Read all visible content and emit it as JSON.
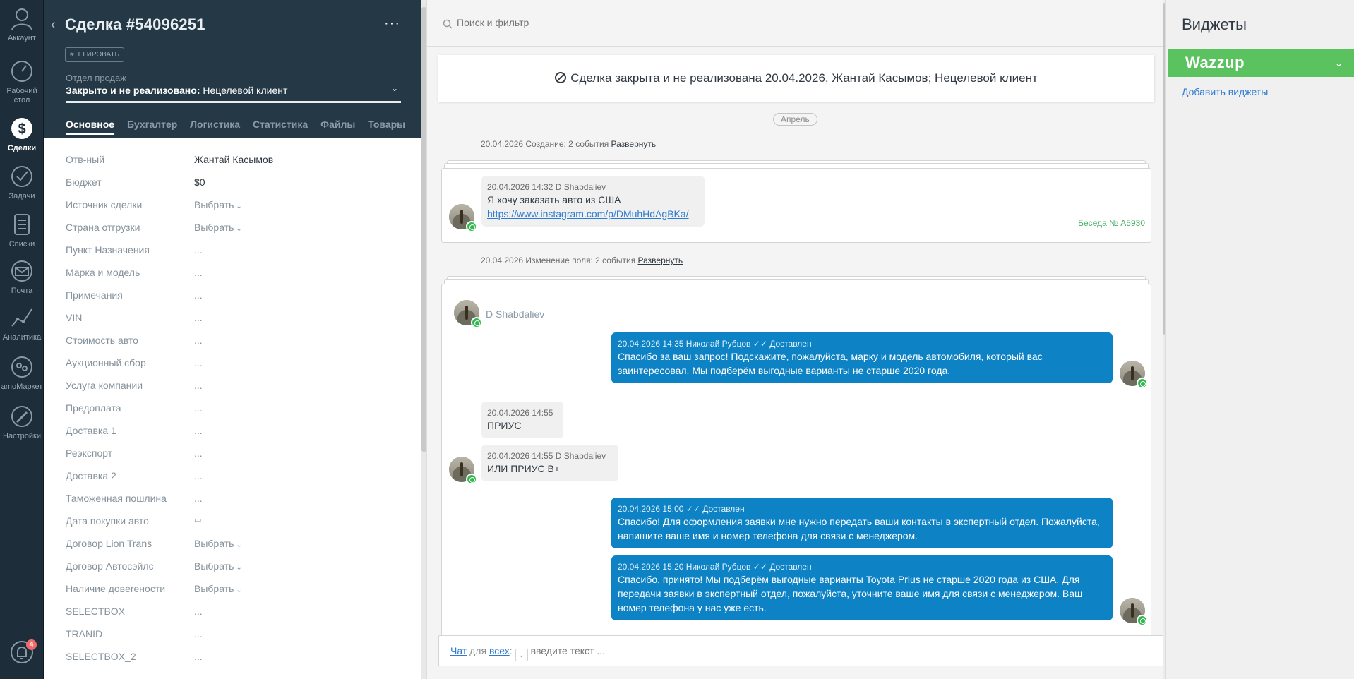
{
  "nav": {
    "items": [
      {
        "label": "Аккаунт"
      },
      {
        "label": "Рабочий стол"
      },
      {
        "label": "Сделки"
      },
      {
        "label": "Задачи"
      },
      {
        "label": "Списки"
      },
      {
        "label": "Почта"
      },
      {
        "label": "Аналитика"
      },
      {
        "label": "amoМаркет"
      },
      {
        "label": "Настройки"
      }
    ],
    "notifications_badge": "4"
  },
  "card": {
    "title": "Сделка #54096251",
    "more": "···",
    "tag_button": "#ТЕГИРОВАТЬ",
    "pipeline_label": "Отдел продаж",
    "pipeline_status_bold": "Закрыто и не реализовано:",
    "pipeline_status_reason": " Нецелевой клиент",
    "tabs": [
      "Основное",
      "Бухгалтер",
      "Логистика",
      "Статистика",
      "Файлы",
      "Товары"
    ],
    "tabs_more": "···",
    "fields": [
      {
        "label": "Отв-ный",
        "value": "Жантай Касымов"
      },
      {
        "label": "Бюджет",
        "value": "$0"
      },
      {
        "label": "Источник сделки",
        "value": "Выбрать"
      },
      {
        "label": "Страна отгрузки",
        "value": "Выбрать"
      },
      {
        "label": "Пункт Назначения",
        "value": "..."
      },
      {
        "label": "Марка и модель",
        "value": "..."
      },
      {
        "label": "Примечания",
        "value": "..."
      },
      {
        "label": "VIN",
        "value": "..."
      },
      {
        "label": "Стоимость авто",
        "value": "..."
      },
      {
        "label": "Аукционный сбор",
        "value": "..."
      },
      {
        "label": "Услуга компании",
        "value": "..."
      },
      {
        "label": "Предоплата",
        "value": "..."
      },
      {
        "label": "Доставка 1",
        "value": "..."
      },
      {
        "label": "Реэкспорт",
        "value": "..."
      },
      {
        "label": "Доставка 2",
        "value": "..."
      },
      {
        "label": "Таможенная пошлина",
        "value": "..."
      },
      {
        "label": "Дата покупки авто",
        "value": "▭"
      },
      {
        "label": "Договор Lion Trans",
        "value": "Выбрать"
      },
      {
        "label": "Договор Автосэйлс",
        "value": "Выбрать"
      },
      {
        "label": "Наличие довerености",
        "value": "Выбрать"
      },
      {
        "label": "SELECTBOX",
        "value": "..."
      },
      {
        "label": "TRANID",
        "value": "..."
      },
      {
        "label": "SELECTBOX_2",
        "value": "..."
      }
    ]
  },
  "feed": {
    "search_placeholder": "Поиск и фильтр",
    "closed_banner": "Сделка закрыта и не реализована 20.04.2026, Жантай Касымов; Нецелевой клиент",
    "month": "Апрель",
    "note1_text": "20.04.2026 Создание: 2 события ",
    "note1_link": "Развернуть",
    "note2_text": "20.04.2026 Изменение поля: 2 события ",
    "note2_link": "Развернуть",
    "msg1": {
      "meta": "20.04.2026 14:32 D Shabdaliev",
      "text": "Я хочу заказать авто из США",
      "link": "https://www.instagram.com/p/DMuhHdAgBKa/"
    },
    "conv_number": "Беседа № A5930",
    "sender_name": "D Shabdaliev",
    "msg2": {
      "meta": "20.04.2026 14:35 Николай Рубцов",
      "status": "Доставлен",
      "text": "Спасибо за ваш запрос! Подскажите, пожалуйста, марку и модель автомобиля, который вас заинтересовал. Мы подберём выгодные варианты не старше 2020 года."
    },
    "msg3": {
      "meta": "20.04.2026 14:55",
      "text": "ПРИУС"
    },
    "msg4": {
      "meta": "20.04.2026 14:55 D Shabdaliev",
      "text": "ИЛИ ПРИУС В+"
    },
    "msg5": {
      "meta": "20.04.2026 15:00",
      "status": "Доставлен",
      "text": "Спасибо! Для оформления заявки мне нужно передать ваши контакты в экспертный отдел. Пожалуйста, напишите ваше имя и номер телефона для связи с менеджером."
    },
    "msg6": {
      "meta": "20.04.2026 15:20 Николай Рубцов",
      "status": "Доставлен",
      "text": "Спасибо, принято! Мы подберём выгодные варианты Toyota Prius не старше 2020 года из США. Для передачи заявки в экспертный отдел, пожалуйста, уточните ваше имя для связи с менеджером. Ваш номер телефона у нас уже есть."
    },
    "composer": {
      "chat": "Чат",
      "for": " для ",
      "all": "всех",
      "colon": ":",
      "placeholder": "введите текст ..."
    }
  },
  "widgets": {
    "title": "Виджеты",
    "wazzup": "Wazzup",
    "add": "Добавить виджеты"
  }
}
